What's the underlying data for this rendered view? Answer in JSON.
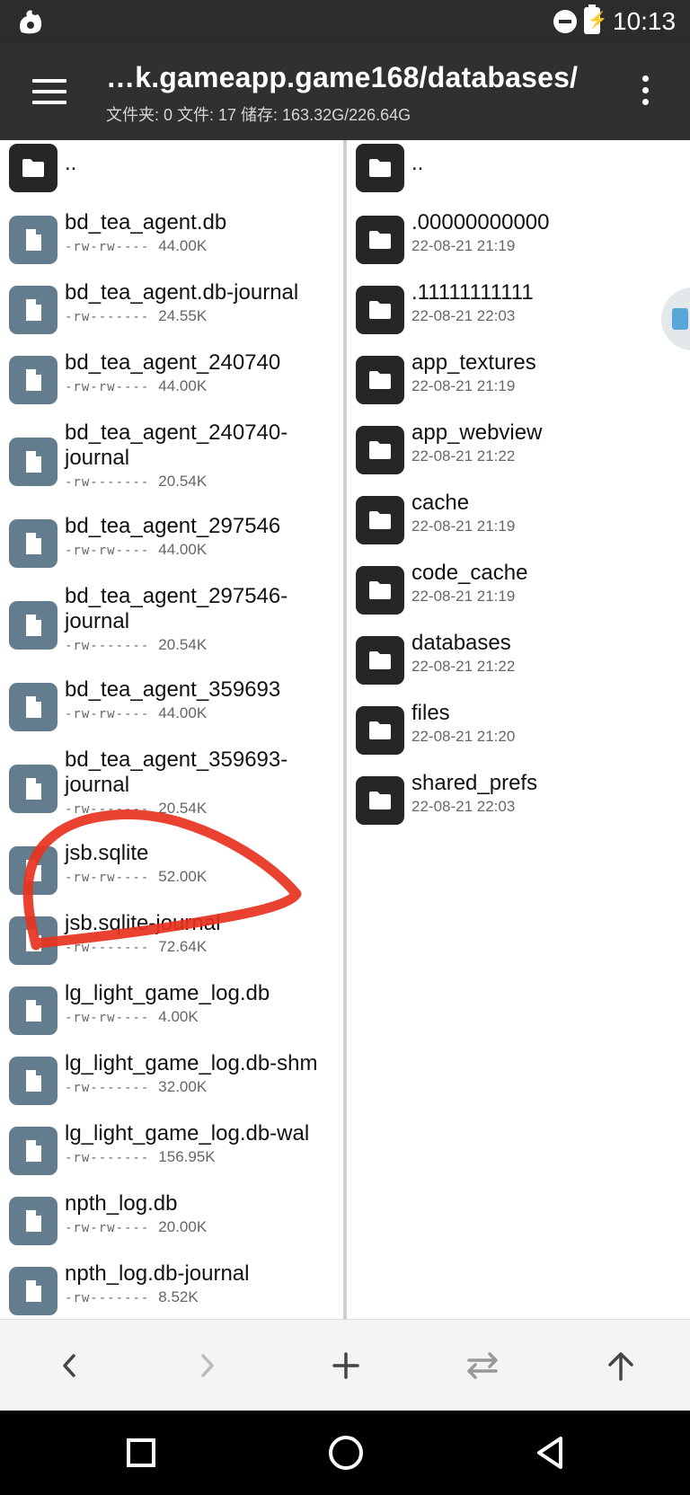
{
  "status_bar": {
    "time": "10:13",
    "battery_glyph": "⚡"
  },
  "app_bar": {
    "title": "…k.gameapp.game168/databases/",
    "subtitle": "文件夹: 0  文件: 17  储存: 163.32G/226.64G"
  },
  "left_pane": {
    "up_label": "..",
    "files": [
      {
        "name": "bd_tea_agent.db",
        "perm": "-rw-rw----",
        "size": "44.00K"
      },
      {
        "name": "bd_tea_agent.db-journal",
        "perm": "-rw-------",
        "size": "24.55K"
      },
      {
        "name": "bd_tea_agent_240740",
        "perm": "-rw-rw----",
        "size": "44.00K"
      },
      {
        "name": "bd_tea_agent_240740-",
        "name2": "journal",
        "perm": "-rw-------",
        "size": "20.54K"
      },
      {
        "name": "bd_tea_agent_297546",
        "perm": "-rw-rw----",
        "size": "44.00K"
      },
      {
        "name": "bd_tea_agent_297546-",
        "name2": "journal",
        "perm": "-rw-------",
        "size": "20.54K"
      },
      {
        "name": "bd_tea_agent_359693",
        "perm": "-rw-rw----",
        "size": "44.00K"
      },
      {
        "name": "bd_tea_agent_359693-",
        "name2": "journal",
        "perm": "-rw-------",
        "size": "20.54K"
      },
      {
        "name": "jsb.sqlite",
        "perm": "-rw-rw----",
        "size": "52.00K"
      },
      {
        "name": "jsb.sqlite-journal",
        "perm": "-rw-------",
        "size": "72.64K"
      },
      {
        "name": "lg_light_game_log.db",
        "perm": "-rw-rw----",
        "size": "4.00K"
      },
      {
        "name": "lg_light_game_log.db-shm",
        "perm": "-rw-------",
        "size": "32.00K"
      },
      {
        "name": "lg_light_game_log.db-wal",
        "perm": "-rw-------",
        "size": "156.95K"
      },
      {
        "name": "npth_log.db",
        "perm": "-rw-rw----",
        "size": "20.00K"
      },
      {
        "name": "npth_log.db-journal",
        "perm": "-rw-------",
        "size": "8.52K"
      }
    ]
  },
  "right_pane": {
    "up_label": "..",
    "folders": [
      {
        "name": ".00000000000",
        "date": "22-08-21 21:19"
      },
      {
        "name": ".11111111111",
        "date": "22-08-21 22:03"
      },
      {
        "name": "app_textures",
        "date": "22-08-21 21:19"
      },
      {
        "name": "app_webview",
        "date": "22-08-21 21:22"
      },
      {
        "name": "cache",
        "date": "22-08-21 21:19"
      },
      {
        "name": "code_cache",
        "date": "22-08-21 21:19"
      },
      {
        "name": "databases",
        "date": "22-08-21 21:22"
      },
      {
        "name": "files",
        "date": "22-08-21 21:20"
      },
      {
        "name": "shared_prefs",
        "date": "22-08-21 22:03"
      }
    ]
  },
  "toolbar": {
    "buttons": [
      "back-icon",
      "forward-icon",
      "add-icon",
      "swap-icon",
      "up-icon"
    ]
  },
  "annotation": {
    "color": "#e8321e"
  }
}
